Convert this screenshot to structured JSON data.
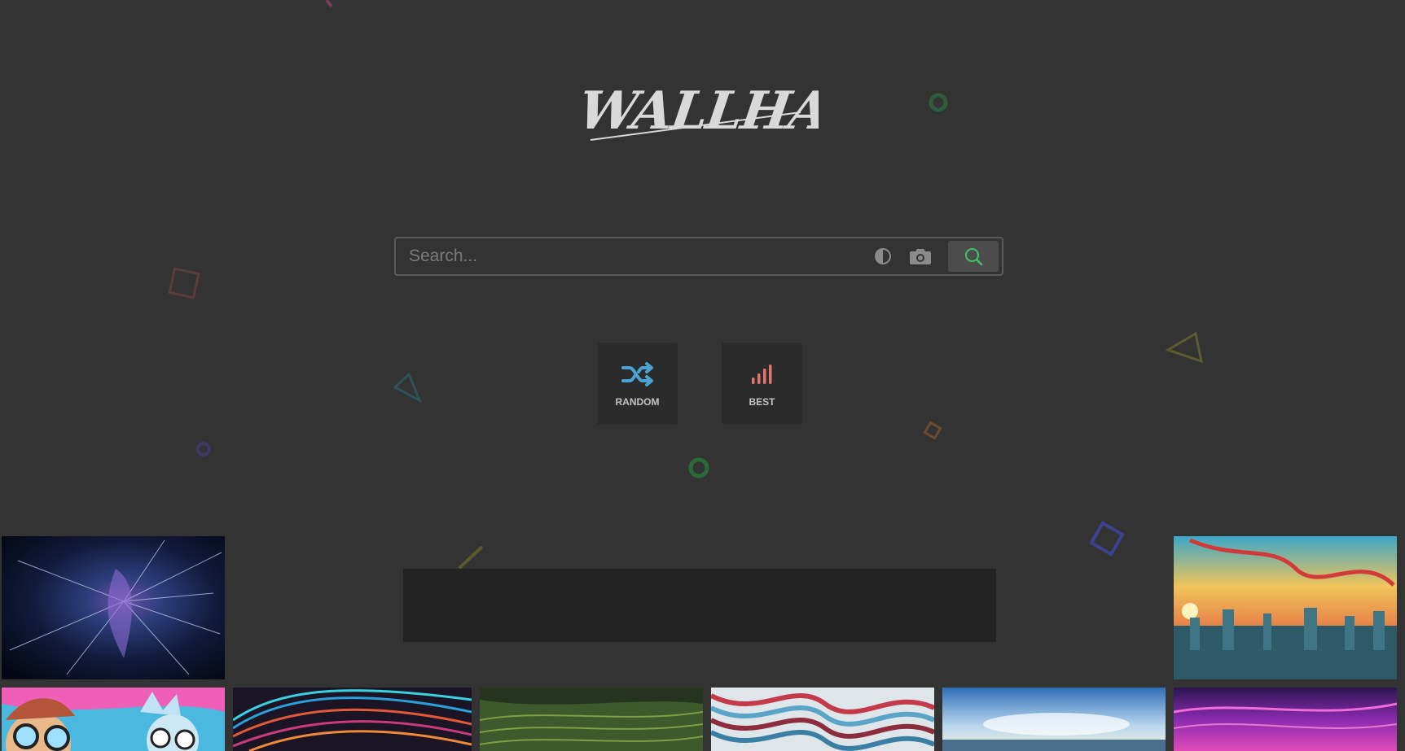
{
  "brand": {
    "logo_text": "WALLHALLA"
  },
  "search": {
    "placeholder": "Search..."
  },
  "icons": {
    "theme": "contrast-icon",
    "camera": "camera-icon",
    "search": "search-icon",
    "random": "shuffle-icon",
    "best": "signal-bars-icon"
  },
  "actions": [
    {
      "label": "RANDOM",
      "color": "#4aa3d0"
    },
    {
      "label": "BEST",
      "color": "#e2746e"
    }
  ],
  "colors": {
    "background": "#333333",
    "search_accent": "#3ec26b",
    "random_accent": "#4aa3d0",
    "best_accent": "#e2746e"
  },
  "gallery": {
    "items": [
      {
        "id": "space-warp"
      },
      {
        "id": "sunset-city"
      },
      {
        "id": "cartoon-characters"
      },
      {
        "id": "color-streaks"
      },
      {
        "id": "green-terraces"
      },
      {
        "id": "wavy-stripes"
      },
      {
        "id": "ocean-sky"
      },
      {
        "id": "purple-sky"
      }
    ]
  }
}
